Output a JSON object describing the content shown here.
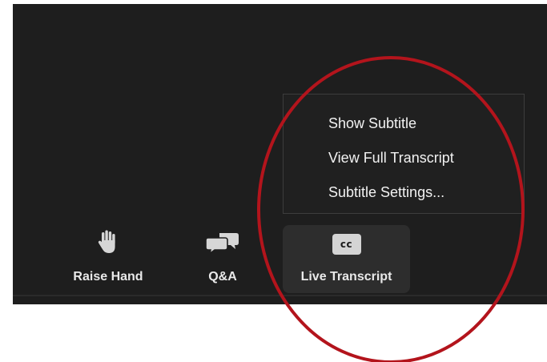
{
  "popup_menu": {
    "items": [
      "Show Subtitle",
      "View Full Transcript",
      "Subtitle Settings..."
    ]
  },
  "toolbar": {
    "raise_hand": {
      "label": "Raise Hand",
      "icon": "hand-icon"
    },
    "qa": {
      "label": "Q&A",
      "icon": "chat-bubbles-icon"
    },
    "live_transcript": {
      "label": "Live Transcript",
      "icon": "cc-icon",
      "badge": "cc"
    }
  },
  "colors": {
    "background": "#1e1e1e",
    "popup": "#202020",
    "active_button": "#2d2d2d",
    "annotation_ellipse": "#b3141c"
  }
}
